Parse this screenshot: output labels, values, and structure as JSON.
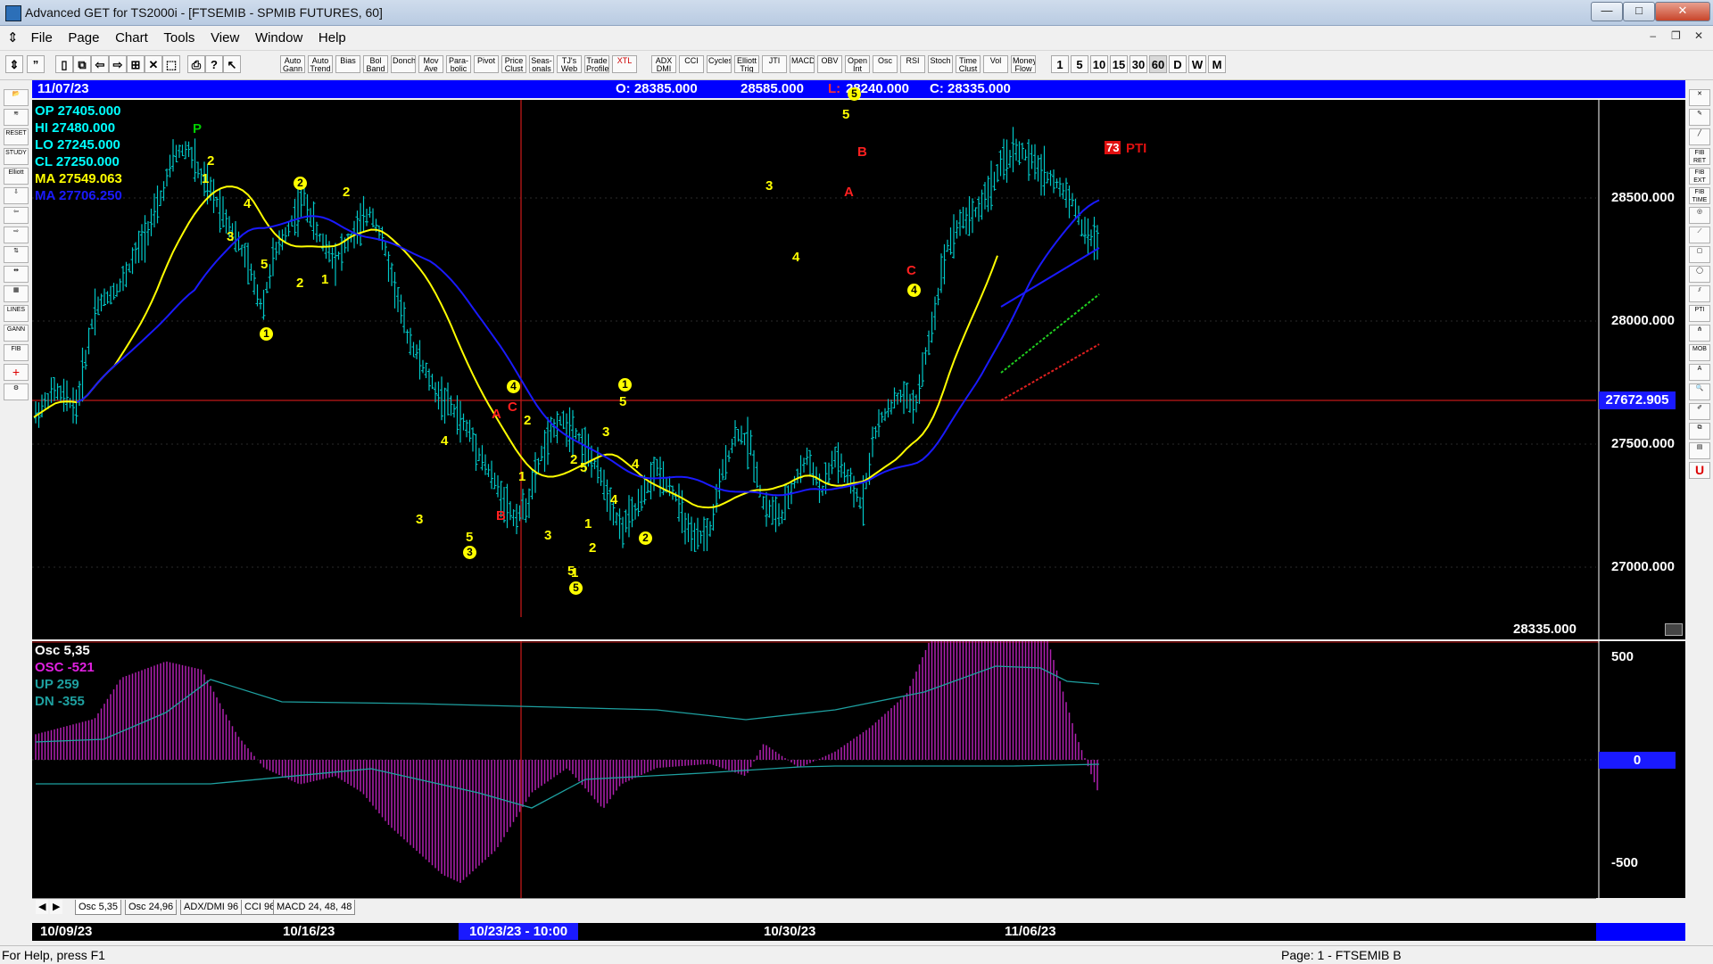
{
  "window": {
    "title": "Advanced GET for TS2000i - [FTSEMIB - SPMIB FUTURES, 60]",
    "minimize": "—",
    "maximize": "□",
    "close": "✕"
  },
  "menu": {
    "items": [
      "File",
      "Page",
      "Chart",
      "Tools",
      "View",
      "Window",
      "Help"
    ]
  },
  "toolbar": {
    "study_buttons": [
      "Auto Gann",
      "Auto Trend",
      "Bias",
      "Bol Band",
      "Donch",
      "Mov Ave",
      "Para- bolic",
      "Pivot",
      "Price Clust",
      "Seas- onals",
      "TJ's Web",
      "Trade Profile",
      "XTL",
      "ADX DMI",
      "CCI",
      "Cycles",
      "Elliott Trig",
      "JTI",
      "MACD",
      "OBV",
      "Open Int",
      "Osc",
      "RSI",
      "Stoch",
      "Time Clust",
      "Vol",
      "Money Flow"
    ],
    "intervals": [
      "1",
      "5",
      "10",
      "15",
      "30",
      "60",
      "D",
      "W",
      "M"
    ]
  },
  "header": {
    "date": "11/07/23",
    "open_label": "O: 28385.000",
    "high_value": "28585.000",
    "low_prefix": "L:",
    "low_value": "28240.000",
    "close_label": "C: 28335.000"
  },
  "info": {
    "op": "OP  27405.000",
    "hi": "HI    27480.000",
    "lo": "LO  27245.000",
    "cl": "CL   27250.000",
    "ma1": "MA  27549.063",
    "ma2": "MA  27706.250"
  },
  "price_axis": [
    "28500.000",
    "28000.000",
    "27500.000",
    "27000.000"
  ],
  "crosshair_price": "27672.905",
  "last_price": "28335.000",
  "pti": {
    "value": "73",
    "label": "PTI"
  },
  "osc": {
    "title": "Osc 5,35",
    "osc_line": "OSC -521",
    "up_line": "UP    259",
    "dn_line": "DN    -355",
    "axis": [
      "500",
      "0",
      "-500"
    ]
  },
  "tabs": [
    "Osc 5,35",
    "Osc 24,96",
    "ADX/DMI 96",
    "CCI 96",
    "MACD 24, 48, 48"
  ],
  "time_axis": [
    "10/09/23",
    "10/16/23",
    "10/23/23 - 10:00",
    "10/30/23",
    "11/06/23"
  ],
  "status": {
    "help": "For Help, press F1",
    "page": "Page: 1 - FTSEMIB B"
  },
  "colors": {
    "bars": "#00c8c8",
    "ma_yellow": "#ffff00",
    "ma_blue": "#1a1aff",
    "osc_hist": "#b020b0",
    "wave_yellow": "#ffff00",
    "wave_red": "#ff2020"
  },
  "wave_labels": {
    "green": [
      "P"
    ],
    "yellow": [
      "2",
      "1",
      "4",
      "3",
      "5",
      "2",
      "2",
      "1",
      "4",
      "3",
      "5",
      "2",
      "1",
      "3",
      "2",
      "5",
      "1",
      "3",
      "4",
      "5",
      "5",
      "1",
      "2",
      "3",
      "4",
      "4",
      "5"
    ],
    "yellow_circled": [
      "1",
      "2",
      "4",
      "3",
      "1",
      "5",
      "2",
      "4",
      "5"
    ],
    "red": [
      "A",
      "C",
      "B",
      "B",
      "A",
      "C"
    ]
  }
}
